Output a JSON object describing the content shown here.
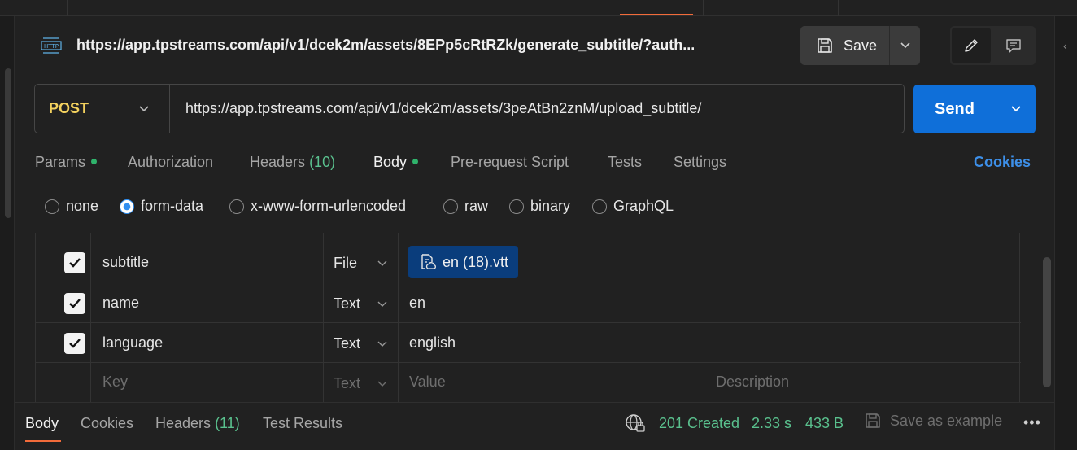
{
  "header": {
    "title": "https://app.tpstreams.com/api/v1/dcek2m/assets/8EPp5cRtRZk/generate_subtitle/?auth...",
    "save_label": "Save"
  },
  "request": {
    "method": "POST",
    "url": "https://app.tpstreams.com/api/v1/dcek2m/assets/3peAtBn2znM/upload_subtitle/",
    "send_label": "Send"
  },
  "tabs": {
    "params": "Params",
    "authorization": "Authorization",
    "headers": "Headers",
    "headers_count": "(10)",
    "body": "Body",
    "prerequest": "Pre-request Script",
    "tests": "Tests",
    "settings": "Settings",
    "cookies": "Cookies"
  },
  "body_modes": {
    "none": "none",
    "form_data": "form-data",
    "urlencoded": "x-www-form-urlencoded",
    "raw": "raw",
    "binary": "binary",
    "graphql": "GraphQL",
    "selected": "form-data"
  },
  "form_rows": [
    {
      "key": "subtitle",
      "type": "File",
      "value": "en (18).vtt",
      "checked": true
    },
    {
      "key": "name",
      "type": "Text",
      "value": "en",
      "checked": true
    },
    {
      "key": "language",
      "type": "Text",
      "value": "english",
      "checked": true
    }
  ],
  "placeholder_row": {
    "key": "Key",
    "type": "Text",
    "value": "Value",
    "description": "Description"
  },
  "response": {
    "tab_body": "Body",
    "tab_cookies": "Cookies",
    "tab_headers": "Headers",
    "headers_count": "(11)",
    "tab_test_results": "Test Results",
    "status": "201 Created",
    "time": "2.33 s",
    "size": "433 B",
    "save_example": "Save as example",
    "more": "•••"
  },
  "colors": {
    "accent": "#f26b3a",
    "send": "#0f6fd9",
    "method": "#f3d15e",
    "success": "#5ac18e",
    "link": "#3d8fe8"
  }
}
